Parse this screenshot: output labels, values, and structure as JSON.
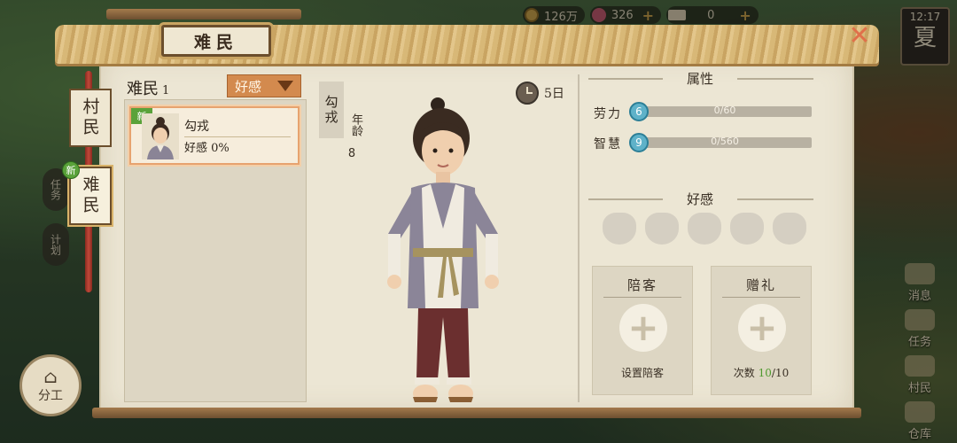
{
  "hud": {
    "coins": "126万",
    "gems": "326",
    "tickets": "0",
    "clock": "12:17",
    "season": "夏"
  },
  "side_left": [
    "任务",
    "计划"
  ],
  "work_button": "分工",
  "side_right": [
    "消息",
    "任务",
    "村民",
    "仓库"
  ],
  "panel": {
    "title": "难民",
    "tabs": [
      {
        "label": "村民"
      },
      {
        "label": "难民",
        "badge": "新"
      }
    ]
  },
  "list": {
    "title": "难民",
    "count": "1",
    "sort_label": "好感",
    "items": [
      {
        "badge": "新",
        "name": "勾戎",
        "affection_label": "好感",
        "affection_value": "0%"
      }
    ]
  },
  "character": {
    "name": "勾戎",
    "age_label": "年龄",
    "age": "8",
    "days": "5日"
  },
  "attributes": {
    "title": "属性",
    "stats": [
      {
        "label": "劳力",
        "level": "6",
        "value": "0/60"
      },
      {
        "label": "智慧",
        "level": "9",
        "value": "0/560"
      }
    ]
  },
  "favor": {
    "title": "好感"
  },
  "actions": {
    "accompany": {
      "title": "陪客",
      "footer": "设置陪客"
    },
    "gift": {
      "title": "赠礼",
      "footer_prefix": "次数",
      "count_used": "10",
      "count_total": "/10"
    }
  }
}
